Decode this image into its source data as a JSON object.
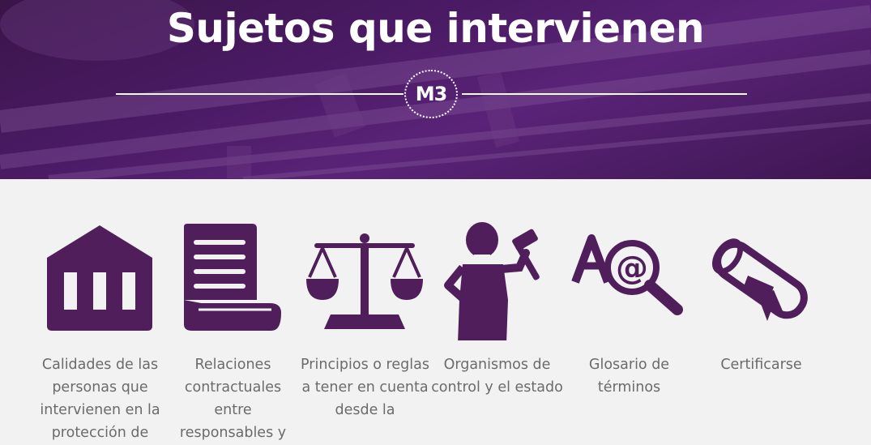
{
  "header": {
    "title": "Sujetos que intervienen",
    "badge": "M3"
  },
  "colors": {
    "brand_purple": "#4f1e5b",
    "hero_overlay": "#4a1a64",
    "label_gray": "#6b6b6b",
    "background": "#f3f2f3"
  },
  "items": [
    {
      "icon": "bank-building-icon",
      "label": "Calidades de las personas que intervienen en la protección de"
    },
    {
      "icon": "document-scroll-icon",
      "label": "Relaciones contractuales entre responsables y"
    },
    {
      "icon": "scales-justice-icon",
      "label": "Principios o reglas a tener en cuenta desde la"
    },
    {
      "icon": "judge-gavel-icon",
      "label": "Organismos de control y el estado"
    },
    {
      "icon": "glossary-search-icon",
      "label": "Glosario de términos"
    },
    {
      "icon": "diploma-certificate-icon",
      "label": "Certificarse"
    }
  ]
}
